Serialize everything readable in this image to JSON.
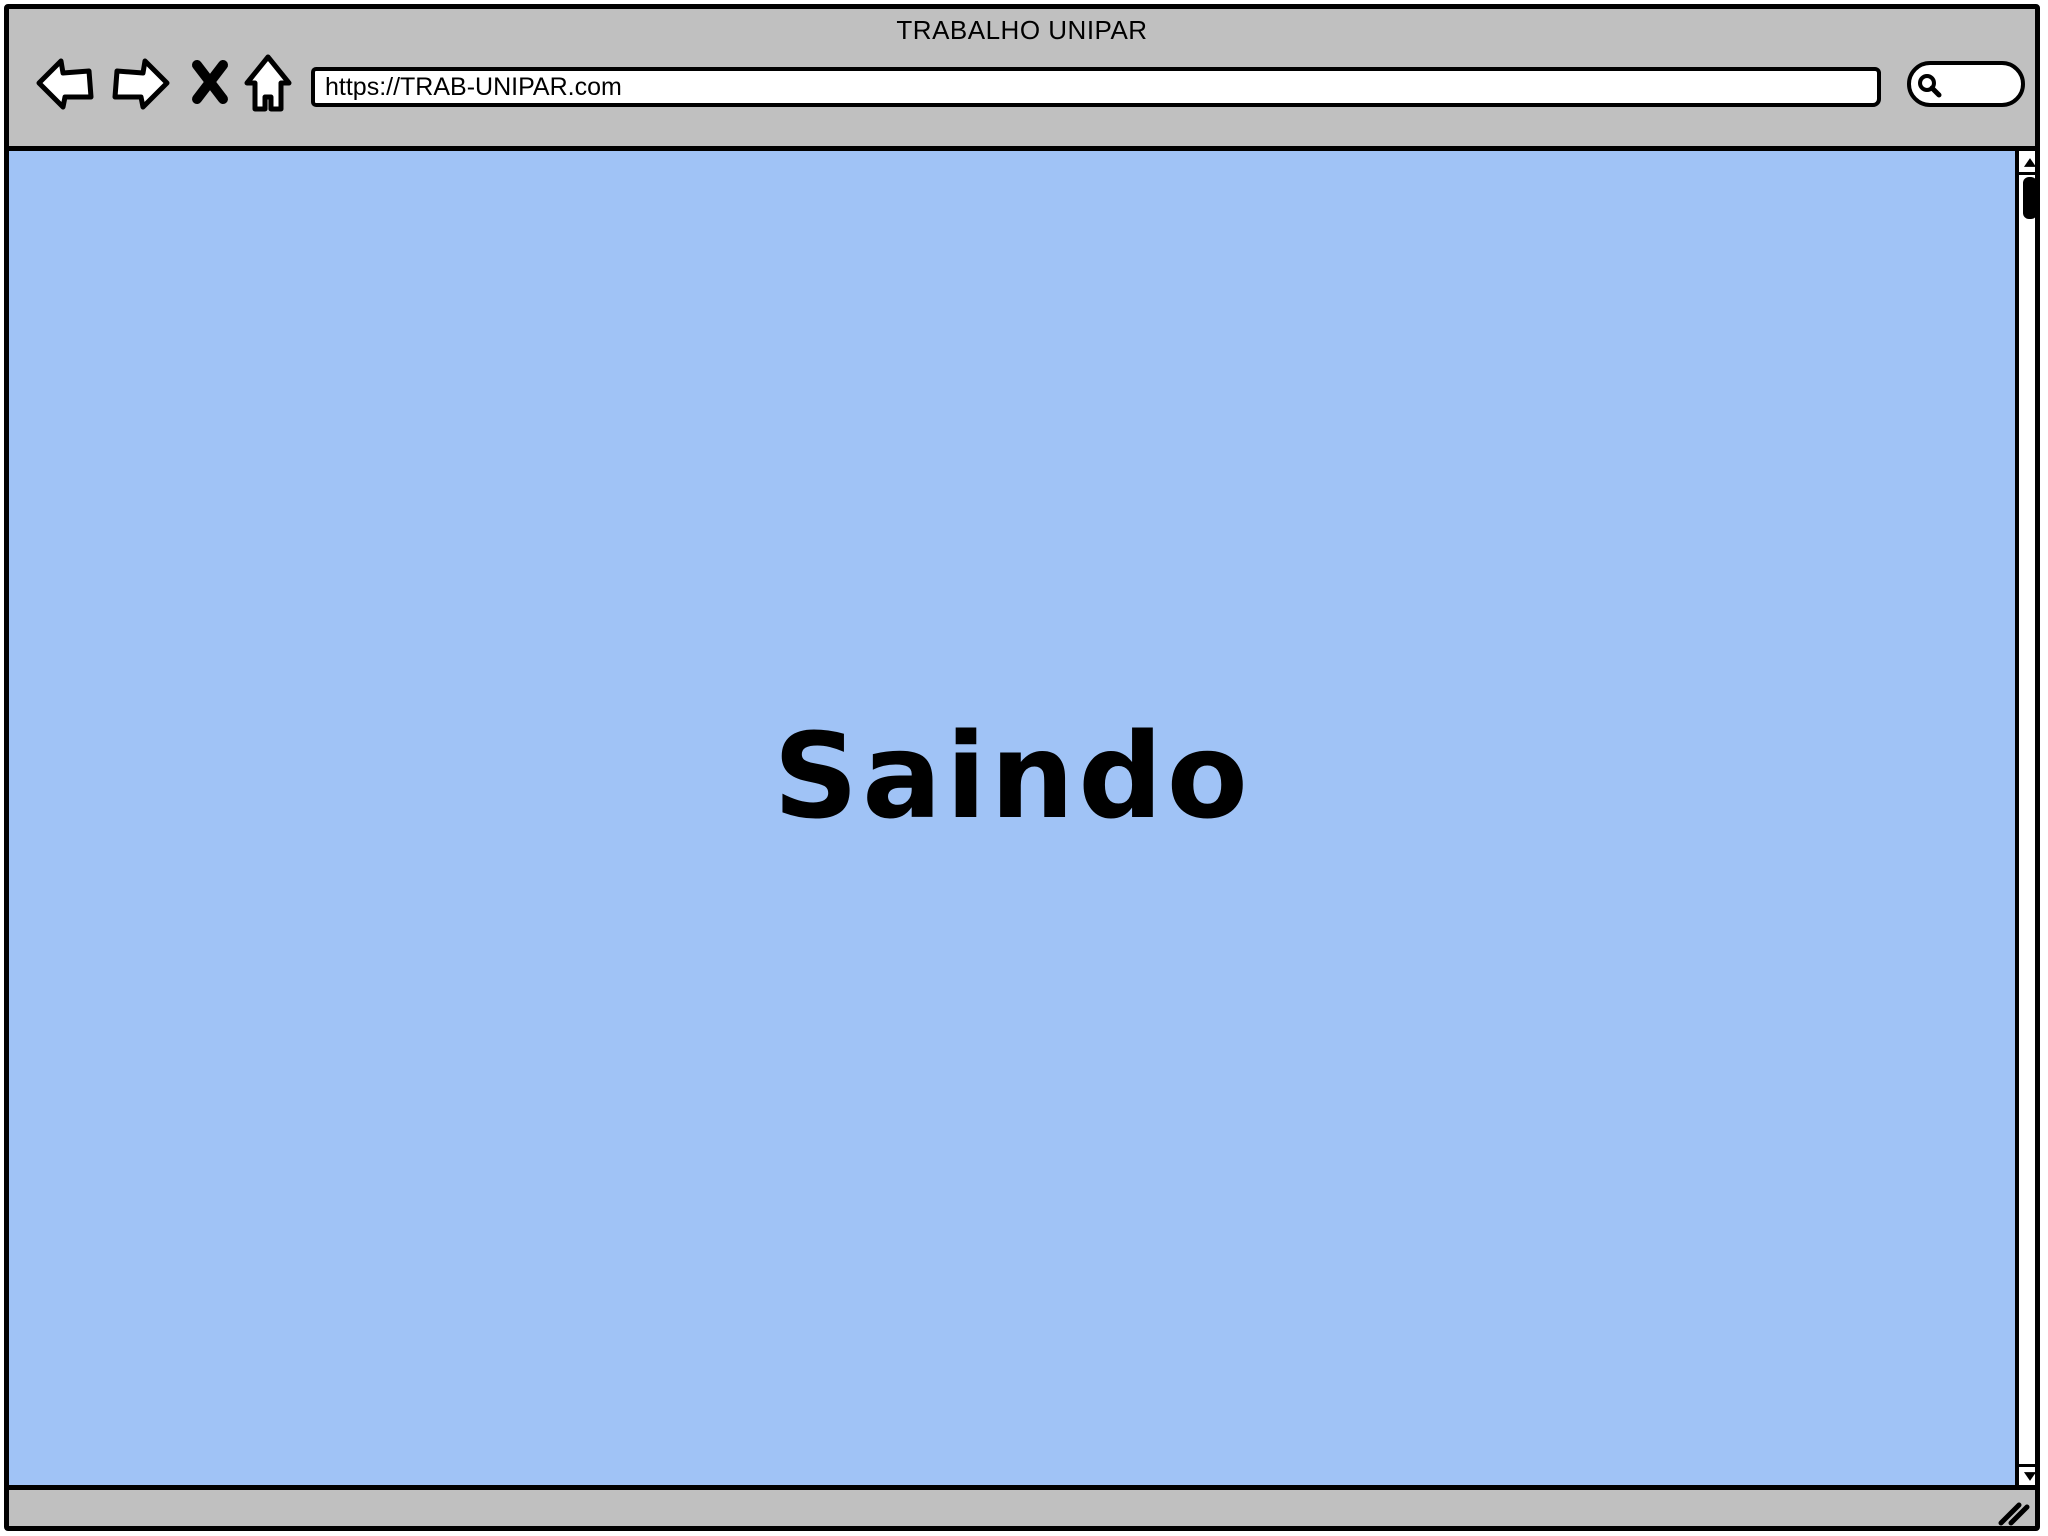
{
  "window": {
    "title": "TRABALHO UNIPAR"
  },
  "toolbar": {
    "back_icon": "arrow-left-icon",
    "forward_icon": "arrow-right-icon",
    "stop_icon": "close-icon",
    "home_icon": "home-icon",
    "url": "https://TRAB-UNIPAR.com",
    "search_icon": "search-icon"
  },
  "content": {
    "heading": "Saindo",
    "background_color": "#a0c3f6"
  },
  "colors": {
    "chrome": "#c0c0c0",
    "outline": "#000000"
  }
}
